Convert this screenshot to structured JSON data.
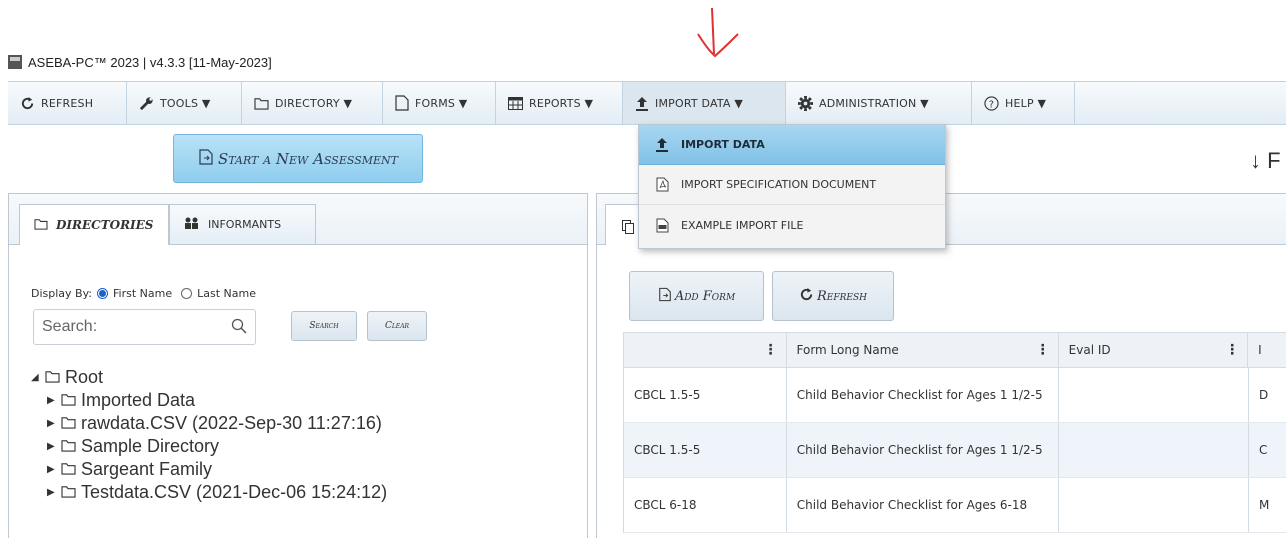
{
  "window": {
    "title": "ASEBA-PC™ 2023 | v4.3.3  [11-May-2023]"
  },
  "menubar": {
    "items": [
      {
        "label": "REFRESH",
        "icon": "refresh-icon"
      },
      {
        "label": "TOOLS ▼",
        "icon": "wrench-icon"
      },
      {
        "label": "DIRECTORY ▼",
        "icon": "folder-icon"
      },
      {
        "label": "FORMS ▼",
        "icon": "document-icon"
      },
      {
        "label": "REPORTS ▼",
        "icon": "table-icon"
      },
      {
        "label": "IMPORT DATA ▼",
        "icon": "upload-icon"
      },
      {
        "label": "ADMINISTRATION ▼",
        "icon": "gear-icon"
      },
      {
        "label": "HELP ▼",
        "icon": "question-icon"
      }
    ]
  },
  "import_dropdown": {
    "items": [
      {
        "label": "IMPORT DATA",
        "icon": "upload-icon"
      },
      {
        "label": "IMPORT SPECIFICATION DOCUMENT",
        "icon": "pdf-icon"
      },
      {
        "label": "EXAMPLE IMPORT FILE",
        "icon": "csv-icon"
      }
    ]
  },
  "toolbar": {
    "start_assessment": "Start a New Assessment",
    "right_cut_label": "↓ F"
  },
  "left_panel": {
    "tabs": [
      {
        "label": "DIRECTORIES",
        "icon": "folder-icon"
      },
      {
        "label": "INFORMANTS",
        "icon": "people-icon"
      }
    ],
    "display_by": {
      "label": "Display By:",
      "option1": "First Name",
      "option2": "Last Name",
      "selected": "First Name"
    },
    "search": {
      "placeholder": "Search:",
      "search_button": "Search",
      "clear_button": "Clear"
    },
    "tree": [
      {
        "label": "Root",
        "expanded": true,
        "level": 0
      },
      {
        "label": "Imported Data",
        "level": 1
      },
      {
        "label": "rawdata.CSV (2022-Sep-30 11:27:16)",
        "level": 1
      },
      {
        "label": "Sample Directory",
        "level": 1
      },
      {
        "label": "Sargeant Family",
        "level": 1
      },
      {
        "label": "Testdata.CSV (2021-Dec-06 15:24:12)",
        "level": 1
      }
    ]
  },
  "right_panel": {
    "buttons": {
      "add_form": "Add Form",
      "refresh": "Refresh"
    },
    "table": {
      "columns": [
        "",
        "Form Long Name",
        "Eval ID",
        "I"
      ],
      "rows": [
        [
          "CBCL 1.5-5",
          "Child Behavior Checklist for Ages 1 1/2-5",
          "",
          "D"
        ],
        [
          "CBCL 1.5-5",
          "Child Behavior Checklist for Ages 1 1/2-5",
          "",
          "C"
        ],
        [
          "CBCL 6-18",
          "Child Behavior Checklist for Ages 6-18",
          "",
          "M"
        ]
      ]
    }
  }
}
